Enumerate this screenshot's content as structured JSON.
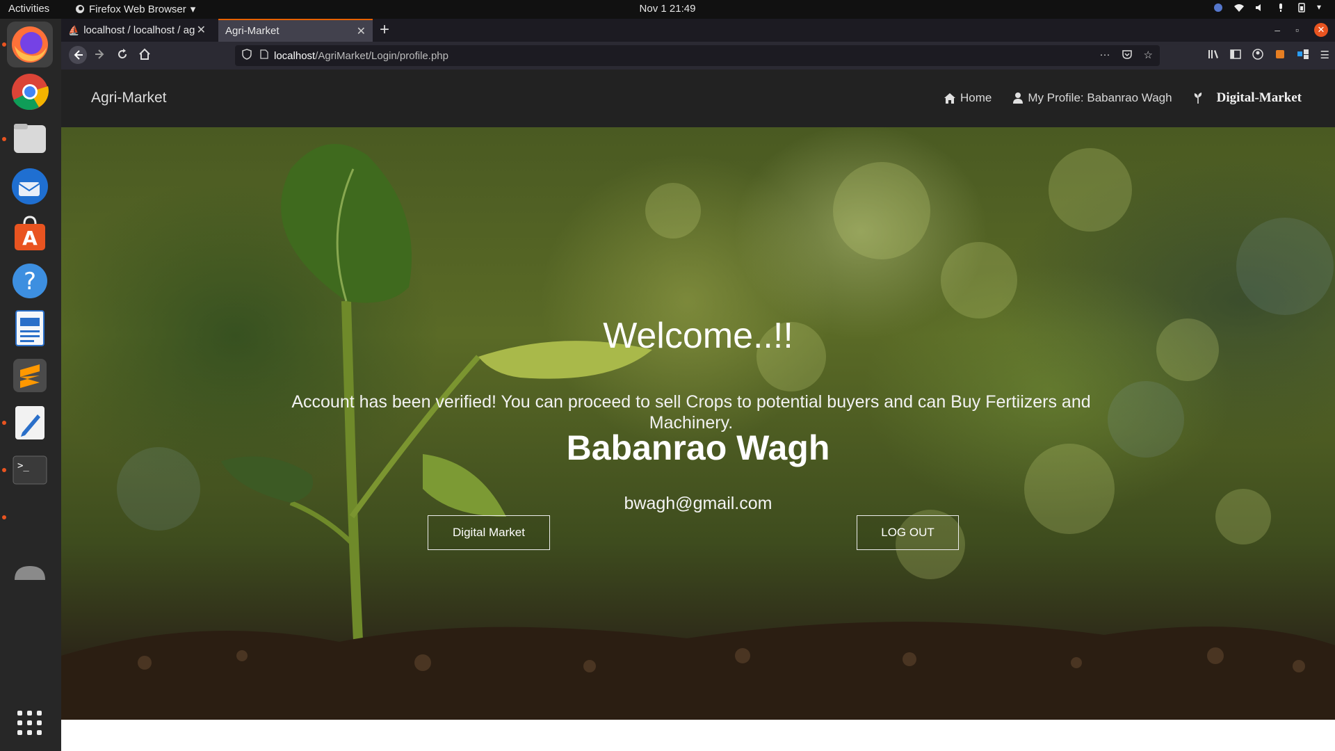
{
  "os": {
    "activities": "Activities",
    "app_menu": "Firefox Web Browser",
    "clock": "Nov 1  21:49"
  },
  "browser": {
    "tabs": [
      {
        "label": "localhost / localhost / ag"
      },
      {
        "label": "Agri-Market"
      }
    ],
    "url_host": "localhost",
    "url_path": "/AgriMarket/Login/profile.php"
  },
  "site": {
    "brand": "Agri-Market",
    "nav": {
      "home": "Home",
      "profile": "My Profile: Babanrao Wagh",
      "market": "Digital-Market"
    }
  },
  "hero": {
    "welcome": "Welcome..!!",
    "message": "Account has been verified! You can proceed to sell Crops to potential buyers and can Buy Fertiizers and Machinery.",
    "user_name": "Babanrao Wagh",
    "email": "bwagh@gmail.com",
    "digital_market_button": "Digital Market",
    "logout_button": "LOG OUT"
  },
  "colors": {
    "accent": "#e95420",
    "nav_bg": "#222222",
    "tab_highlight": "#e66000"
  },
  "dock": [
    "firefox-icon",
    "chrome-icon",
    "files-icon",
    "thunderbird-icon",
    "software-center-icon",
    "help-icon",
    "writer-icon",
    "sublime-icon",
    "text-editor-icon",
    "terminal-icon",
    "app-grid-icon"
  ]
}
